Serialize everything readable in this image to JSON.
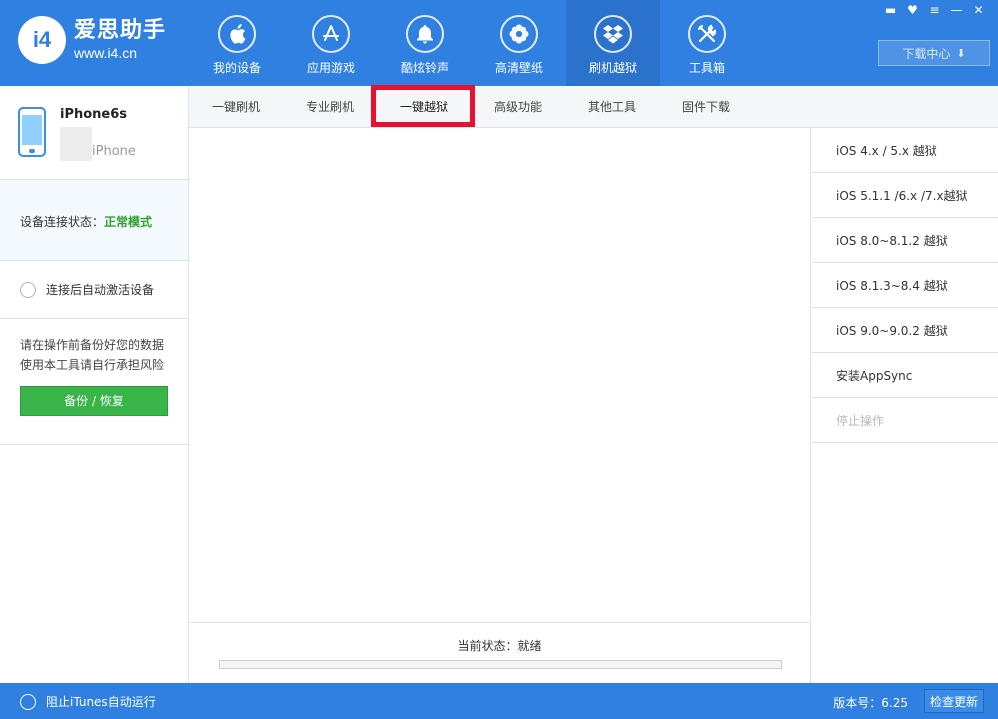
{
  "app": {
    "logo_mark": "i4",
    "name": "爱思助手",
    "url": "www.i4.cn"
  },
  "nav": [
    {
      "label": "我的设备",
      "icon": "apple-icon",
      "glyph": ""
    },
    {
      "label": "应用游戏",
      "icon": "app-store-icon",
      "glyph": "A"
    },
    {
      "label": "酷炫铃声",
      "icon": "bell-icon",
      "glyph": "🔔"
    },
    {
      "label": "高清壁纸",
      "icon": "flower-icon",
      "glyph": "❀"
    },
    {
      "label": "刷机越狱",
      "icon": "box-icon",
      "glyph": "⬡"
    },
    {
      "label": "工具箱",
      "icon": "tools-icon",
      "glyph": "✕"
    }
  ],
  "nav_active_index": 4,
  "window_controls": {
    "feedback": "▬",
    "skin": "♥",
    "menu": "≡",
    "minimize": "—",
    "close": "✕"
  },
  "download_center": {
    "label": "下载中心",
    "icon": "download-icon",
    "glyph": "⬇"
  },
  "device": {
    "name": "iPhone6s",
    "model": "iPhone"
  },
  "connection": {
    "label": "设备连接状态：",
    "value": "正常模式",
    "value_color": "#2fa12f"
  },
  "auto_activate": {
    "label": "连接后自动激活设备"
  },
  "notice": {
    "line1": "请在操作前备份好您的数据",
    "line2": "使用本工具请自行承担风险"
  },
  "backup_button": {
    "label": "备份 / 恢复"
  },
  "sub_tabs": [
    "一键刷机",
    "专业刷机",
    "一键越狱",
    "高级功能",
    "其他工具",
    "固件下载"
  ],
  "sub_tab_active_index": 2,
  "right_menu": [
    {
      "label": "iOS 4.x / 5.x 越狱",
      "disabled": false
    },
    {
      "label": "iOS 5.1.1 /6.x /7.x越狱",
      "disabled": false
    },
    {
      "label": "iOS 8.0~8.1.2 越狱",
      "disabled": false
    },
    {
      "label": "iOS 8.1.3~8.4 越狱",
      "disabled": false
    },
    {
      "label": "iOS 9.0~9.0.2 越狱",
      "disabled": false
    },
    {
      "label": "安装AppSync",
      "disabled": false
    },
    {
      "label": "停止操作",
      "disabled": true
    }
  ],
  "current_status": {
    "label": "当前状态：就绪"
  },
  "progress": {
    "value": 0
  },
  "footer": {
    "itunes_label": "阻止iTunes自动运行",
    "version_label": "版本号：6.25",
    "update_label": "检查更新"
  },
  "colors": {
    "header_blue": "#2f80e0",
    "active_nav": "#2a72cc",
    "green": "#38b449",
    "highlight_red": "#e8112d"
  }
}
